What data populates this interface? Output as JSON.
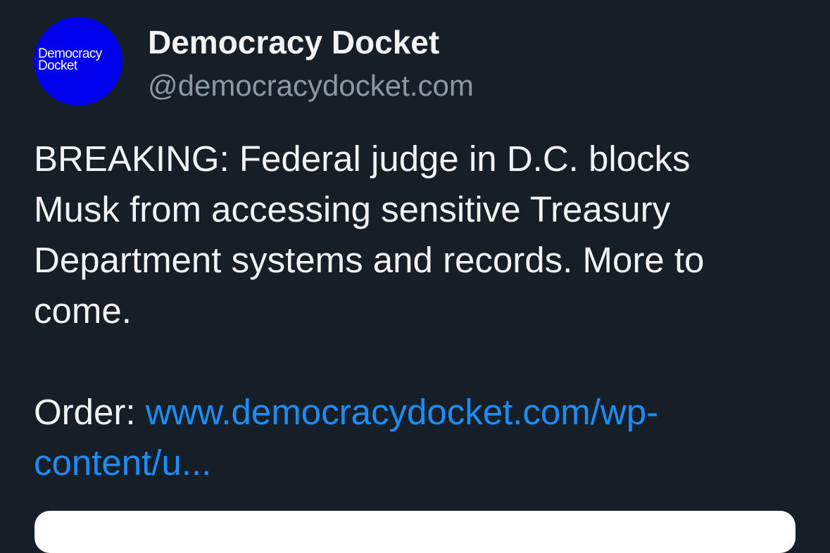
{
  "author": {
    "display_name": "Democracy Docket",
    "handle": "@democracydocket.com",
    "avatar": {
      "line1": "Democracy",
      "line2": "Docket",
      "color": "#0000ee"
    }
  },
  "post": {
    "text": "BREAKING: Federal judge in D.C. blocks Musk from accessing sensitive Treasury Department systems and records. More to come.",
    "order_label": "Order: ",
    "order_link_line1": "www.democracydocket.com/wp-",
    "order_link_line2": "content/u...",
    "link_color": "#1e8cf5"
  },
  "theme": {
    "background": "#161e27",
    "text": "#f1f3f5",
    "muted": "#8b98a5"
  }
}
